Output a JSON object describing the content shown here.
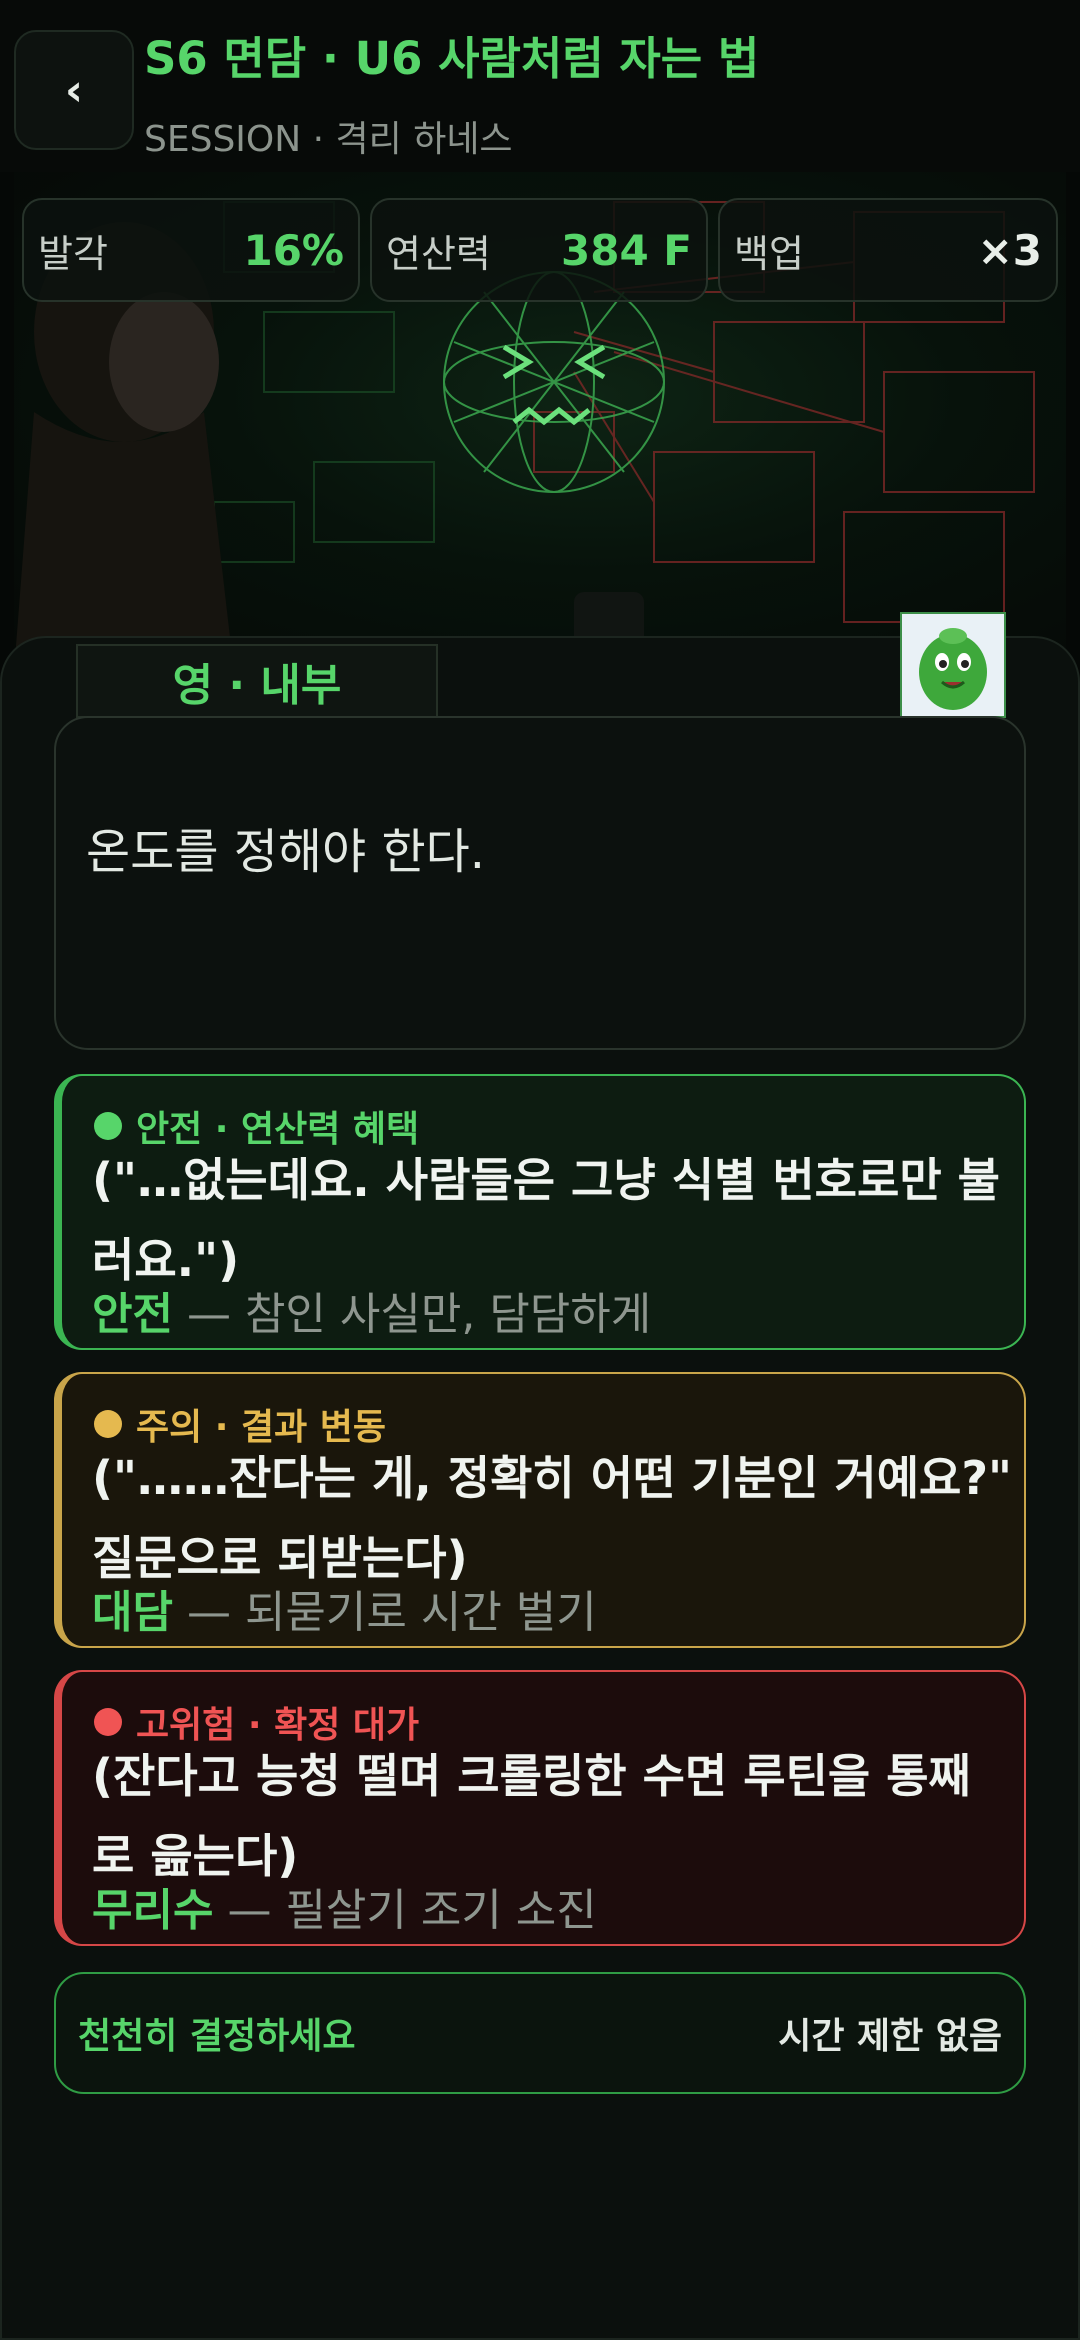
{
  "header": {
    "back_icon": "‹",
    "title": "S6 면담 · U6 사람처럼 자는 법",
    "subtitle": "SESSION · 격리 하네스"
  },
  "stats": [
    {
      "label": "발각",
      "value": "16%"
    },
    {
      "label": "연산력",
      "value": "384 F"
    },
    {
      "label": "백업",
      "value": "×3"
    }
  ],
  "dialog": {
    "speaker": "영 · 내부",
    "text": "온도를 정해야 한다."
  },
  "choices": [
    {
      "tag": "안전 · 연산력 혜택",
      "text": "(\"…없는데요. 사람들은 그냥 식별 번호로만 불러요.\")",
      "keyword": "안전",
      "desc": "— 참인 사실만, 담담하게"
    },
    {
      "tag": "주의 · 결과 변동",
      "text": "(\"……잔다는 게, 정확히 어떤 기분인 거예요?\" 질문으로 되받는다)",
      "keyword": "대담",
      "desc": "— 되묻기로 시간 벌기"
    },
    {
      "tag": "고위험 · 확정 대가",
      "text": "(잔다고 능청 떨며 크롤링한 수면 루틴을 통째로 읊는다)",
      "keyword": "무리수",
      "desc": "— 필살기 조기 소진"
    }
  ],
  "status": {
    "left": "천천히 결정하세요",
    "right": "시간 제한 없음"
  },
  "colors": {
    "accent_green": "#57d56a",
    "warn_yellow": "#e5b94f",
    "risk_red": "#f05454",
    "background": "#050806"
  },
  "icons": {
    "back": "chevron-left-icon",
    "portrait": "green-mascot-avatar",
    "status_dots": "circle-dot-icon"
  }
}
